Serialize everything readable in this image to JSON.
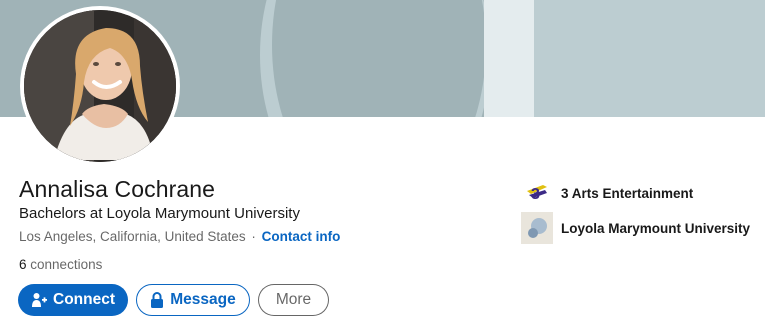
{
  "profile": {
    "name": "Annalisa Cochrane",
    "headline": "Bachelors at Loyola Marymount University",
    "location": "Los Angeles, California, United States",
    "separator": "·",
    "contact_info": "Contact info",
    "connections_count": "6",
    "connections_label": "connections"
  },
  "actions": {
    "connect": "Connect",
    "message": "Message",
    "more": "More"
  },
  "organizations": [
    {
      "name": "3 Arts Entertainment",
      "icon": "3-arts-logo"
    },
    {
      "name": "Loyola Marymount University",
      "icon": "lmu-logo"
    }
  ],
  "colors": {
    "brand_blue": "#0a66c2",
    "banner": "#a0b3b7",
    "banner_light": "#bccdd1"
  }
}
